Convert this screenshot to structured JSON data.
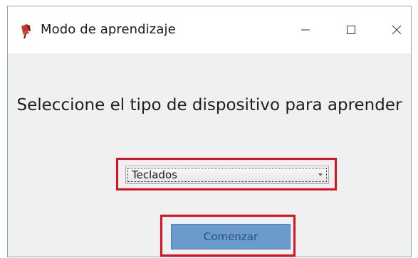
{
  "window": {
    "title": "Modo de aprendizaje",
    "app_icon": "pushpin-icon",
    "controls": {
      "minimize_icon": "minimize-icon",
      "maximize_icon": "maximize-icon",
      "close_icon": "close-icon"
    }
  },
  "main": {
    "prompt": "Seleccione el tipo de dispositivo para aprender",
    "device_select": {
      "selected": "Teclados"
    },
    "start_button": {
      "label": "Comenzar"
    }
  },
  "colors": {
    "highlight": "#e0101e",
    "button_bg": "#6a9bcc",
    "button_text": "#2b4f78",
    "window_bg": "#f0f0f0"
  }
}
